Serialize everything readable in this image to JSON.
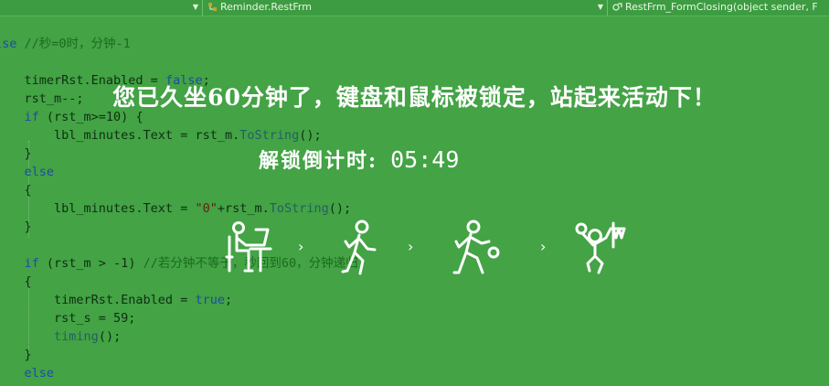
{
  "editor": {
    "nav_bar": {
      "class_dropdown": "Reminder.RestFrm",
      "member_dropdown": "RestFrm_FormClosing(object sender, F",
      "class_icon": "class-icon",
      "member_icon": "method-icon",
      "dropdown_arrow_icon": "chevron-down-icon"
    },
    "code_lines": [
      [
        {
          "t": "lse ",
          "c": "kw"
        },
        {
          "t": "//秒=0时，分钟-1",
          "c": "cm"
        }
      ],
      [],
      [
        {
          "t": "    timerRst.Enabled = ",
          "c": ""
        },
        {
          "t": "false",
          "c": "kw"
        },
        {
          "t": ";",
          "c": ""
        }
      ],
      [
        {
          "t": "    rst_m--;",
          "c": ""
        }
      ],
      [
        {
          "t": "    ",
          "c": ""
        },
        {
          "t": "if",
          "c": "kw"
        },
        {
          "t": " (rst_m>=10) {",
          "c": ""
        }
      ],
      [
        {
          "t": "        lbl_minutes.Text = rst_m.",
          "c": ""
        },
        {
          "t": "ToString",
          "c": "fn"
        },
        {
          "t": "();",
          "c": ""
        }
      ],
      [
        {
          "t": "    }",
          "c": ""
        }
      ],
      [
        {
          "t": "    ",
          "c": ""
        },
        {
          "t": "else",
          "c": "kw"
        }
      ],
      [
        {
          "t": "    {",
          "c": ""
        }
      ],
      [
        {
          "t": "        lbl_minutes.Text = ",
          "c": ""
        },
        {
          "t": "\"0\"",
          "c": "str"
        },
        {
          "t": "+rst_m.",
          "c": ""
        },
        {
          "t": "ToString",
          "c": "fn"
        },
        {
          "t": "();",
          "c": ""
        }
      ],
      [
        {
          "t": "    }",
          "c": ""
        }
      ],
      [],
      [
        {
          "t": "    ",
          "c": ""
        },
        {
          "t": "if",
          "c": "kw"
        },
        {
          "t": " (rst_m > -1) ",
          "c": ""
        },
        {
          "t": "//若分钟不等于，秒回到60，分钟递归",
          "c": "cm"
        }
      ],
      [
        {
          "t": "    {",
          "c": ""
        }
      ],
      [
        {
          "t": "        timerRst.Enabled = ",
          "c": ""
        },
        {
          "t": "true",
          "c": "kw"
        },
        {
          "t": ";",
          "c": ""
        }
      ],
      [
        {
          "t": "        rst_s = 59;",
          "c": ""
        }
      ],
      [
        {
          "t": "        ",
          "c": ""
        },
        {
          "t": "timing",
          "c": "fn"
        },
        {
          "t": "();",
          "c": ""
        }
      ],
      [
        {
          "t": "    }",
          "c": ""
        }
      ],
      [
        {
          "t": "    ",
          "c": ""
        },
        {
          "t": "else",
          "c": "kw"
        }
      ]
    ]
  },
  "overlay": {
    "message": "您已久坐60分钟了，键盘和鼠标被锁定，站起来活动下！",
    "countdown_label": "解锁倒计时:",
    "countdown_time": "05:49",
    "activities": [
      {
        "icon": "person-at-computer-icon"
      },
      {
        "icon": "walking-person-icon"
      },
      {
        "icon": "soccer-player-icon"
      },
      {
        "icon": "basketball-player-icon"
      }
    ],
    "separator_icon": "chevron-right-icon"
  },
  "colors": {
    "background": "#43a345",
    "overlay_text": "#ffffff",
    "code_text": "#0f2f10"
  }
}
